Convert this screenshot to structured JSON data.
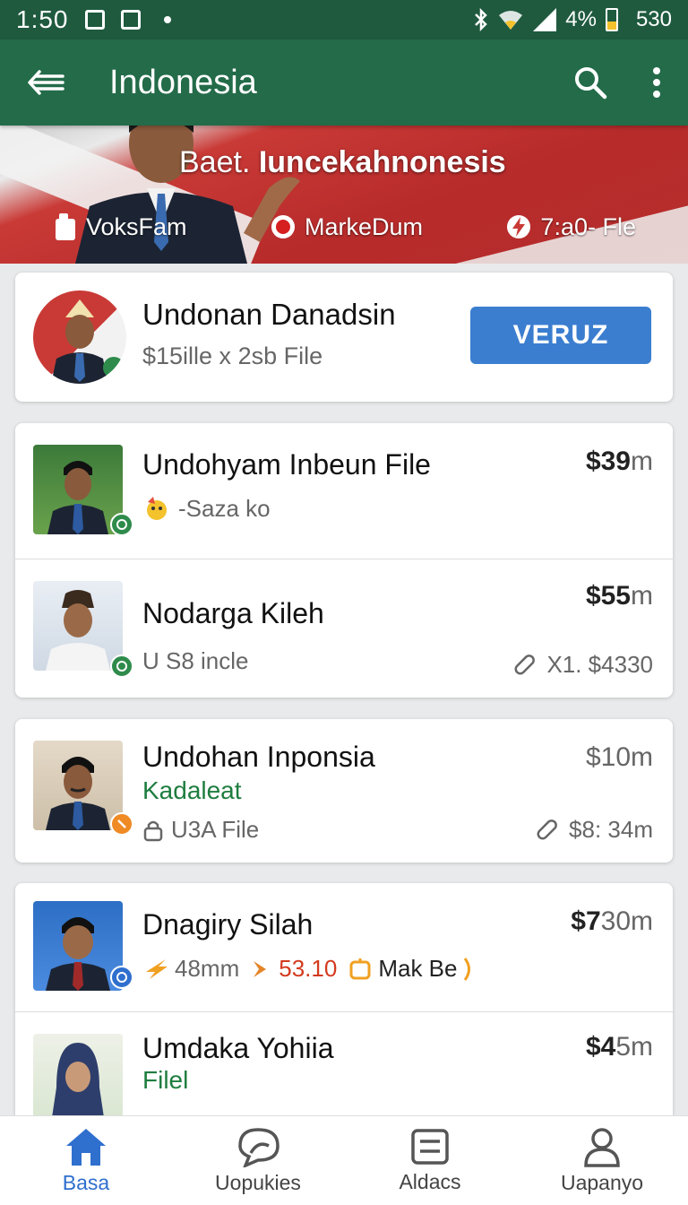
{
  "status": {
    "time": "1:50",
    "battery": "4%",
    "right_time": "530"
  },
  "appbar": {
    "title": "Indonesia"
  },
  "hero": {
    "headline_pre": "Baet.",
    "headline_bold": "Iuncekahnonesis",
    "chips": [
      {
        "label": "VoksFam",
        "icon": "phone-icon"
      },
      {
        "label": "MarkeDum",
        "icon": "record-icon"
      },
      {
        "label": "7:a0- Fle",
        "icon": "flash-icon"
      }
    ]
  },
  "featured": {
    "name": "Undonan Danadsin",
    "sub": "$15ille x 2sb File",
    "button": "VERUZ"
  },
  "list_group_1": [
    {
      "name": "Undohyam Inbeun File",
      "sub": "-Saza ko",
      "price_bold": "$39",
      "price_unit": "m"
    },
    {
      "name": "Nodarga Kileh",
      "sub": "U S8 incle",
      "price_bold": "$55",
      "price_unit": "m",
      "meta": "X1. $4330"
    }
  ],
  "list_group_2": [
    {
      "name": "Undohan Inponsia",
      "sub_green": "Kadaleat",
      "sub": "U3A File",
      "price": "$10m",
      "meta": "$8: 34m"
    }
  ],
  "list_group_3": [
    {
      "name": "Dnagiry Silah",
      "tag1": "48mm",
      "tag2": "53.10",
      "tag3": "Mak Be",
      "price_bold": "$7",
      "price_unit": "30m"
    },
    {
      "name": "Umdaka Yohiia",
      "sub_green": "Filel",
      "price_bold": "$4",
      "price_unit": "5m"
    }
  ],
  "bottom_nav": [
    {
      "label": "Basa",
      "icon": "home-icon",
      "active": true
    },
    {
      "label": "Uopukies",
      "icon": "chat-icon",
      "active": false
    },
    {
      "label": "Aldacs",
      "icon": "list-icon",
      "active": false
    },
    {
      "label": "Uapanyo",
      "icon": "person-icon",
      "active": false
    }
  ],
  "colors": {
    "status_bar": "#1f5a3f",
    "app_bar": "#236b49",
    "accent_button": "#3b7ed0",
    "nav_active": "#2f6fce",
    "green_text": "#1e7d3f"
  }
}
